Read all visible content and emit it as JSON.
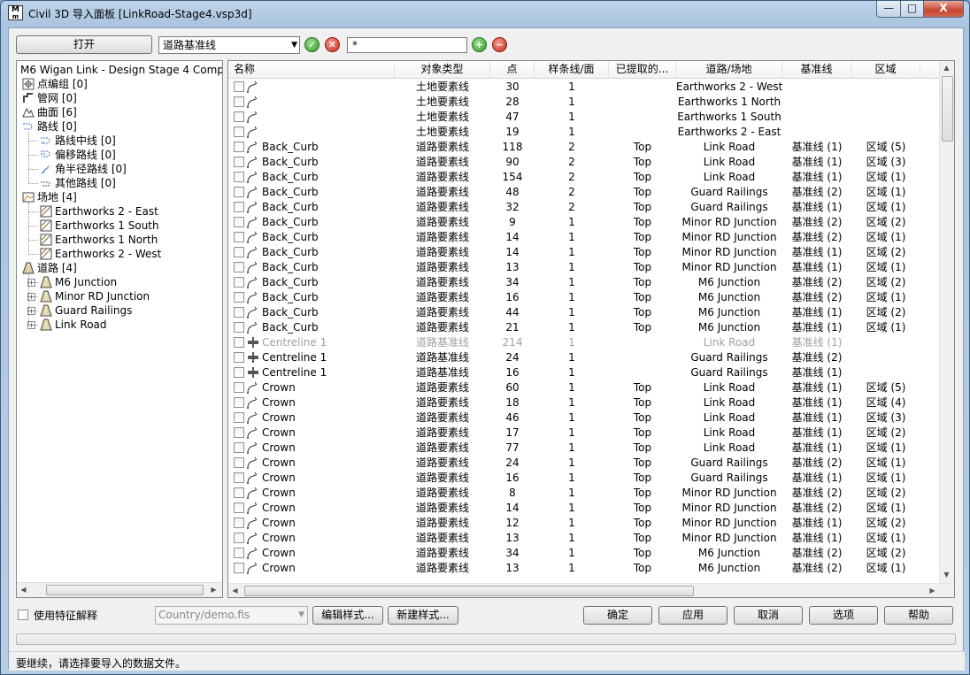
{
  "window": {
    "title": "Civil 3D 导入面板 [LinkRoad-Stage4.vsp3d]",
    "icon_text": "M",
    "minimize": "—",
    "maximize": "□",
    "close": "X"
  },
  "toolbar": {
    "open_label": "打开",
    "type_select_value": "道路基准线",
    "filter_value": "*"
  },
  "tree": {
    "root": "M6 Wigan Link - Design Stage 4 Complete.dwg",
    "items": [
      {
        "label": "点编组 [0]",
        "icon": "point-group-icon"
      },
      {
        "label": "管网 [0]",
        "icon": "pipe-network-icon"
      },
      {
        "label": "曲面 [6]",
        "icon": "surface-icon"
      },
      {
        "label": "路线 [0]",
        "icon": "alignment-icon"
      },
      {
        "label": "路线中线 [0]",
        "icon": "centerline-icon"
      },
      {
        "label": "偏移路线 [0]",
        "icon": "offset-alignment-icon"
      },
      {
        "label": "角半径路线 [0]",
        "icon": "curb-return-icon"
      },
      {
        "label": "其他路线 [0]",
        "icon": "misc-alignment-icon"
      },
      {
        "label": "场地 [4]",
        "icon": "site-icon"
      },
      {
        "label": "Earthworks 2 - East",
        "icon": "site-item-icon"
      },
      {
        "label": "Earthworks 1 South",
        "icon": "site-item-icon"
      },
      {
        "label": "Earthworks 1 North",
        "icon": "site-item-icon"
      },
      {
        "label": "Earthworks 2 - West",
        "icon": "site-item-icon"
      },
      {
        "label": "道路 [4]",
        "icon": "corridor-icon"
      },
      {
        "label": "M6 Junction",
        "icon": "corridor-item-icon"
      },
      {
        "label": "Minor RD Junction",
        "icon": "corridor-item-icon"
      },
      {
        "label": "Guard Railings",
        "icon": "corridor-item-icon"
      },
      {
        "label": "Link Road",
        "icon": "corridor-item-icon"
      }
    ]
  },
  "list": {
    "columns": [
      "名称",
      "对象类型",
      "点",
      "样条线/面",
      "已提取的...",
      "道路/场地",
      "基准线",
      "区域"
    ],
    "rows": [
      {
        "name": "",
        "type": "土地要素线",
        "pts": "30",
        "spl": "1",
        "ext": "",
        "road": "Earthworks 2 - West",
        "base": "",
        "reg": "",
        "icon": "feature-line-icon"
      },
      {
        "name": "",
        "type": "土地要素线",
        "pts": "28",
        "spl": "1",
        "ext": "",
        "road": "Earthworks 1 North",
        "base": "",
        "reg": "",
        "icon": "feature-line-icon"
      },
      {
        "name": "",
        "type": "土地要素线",
        "pts": "47",
        "spl": "1",
        "ext": "",
        "road": "Earthworks 1 South",
        "base": "",
        "reg": "",
        "icon": "feature-line-icon"
      },
      {
        "name": "",
        "type": "土地要素线",
        "pts": "19",
        "spl": "1",
        "ext": "",
        "road": "Earthworks 2 - East",
        "base": "",
        "reg": "",
        "icon": "feature-line-icon"
      },
      {
        "name": "Back_Curb",
        "type": "道路要素线",
        "pts": "118",
        "spl": "2",
        "ext": "Top",
        "road": "Link Road",
        "base": "基准线 (1)",
        "reg": "区域 (5)",
        "icon": "feature-line-icon"
      },
      {
        "name": "Back_Curb",
        "type": "道路要素线",
        "pts": "90",
        "spl": "2",
        "ext": "Top",
        "road": "Link Road",
        "base": "基准线 (1)",
        "reg": "区域 (3)",
        "icon": "feature-line-icon"
      },
      {
        "name": "Back_Curb",
        "type": "道路要素线",
        "pts": "154",
        "spl": "2",
        "ext": "Top",
        "road": "Link Road",
        "base": "基准线 (1)",
        "reg": "区域 (1)",
        "icon": "feature-line-icon"
      },
      {
        "name": "Back_Curb",
        "type": "道路要素线",
        "pts": "48",
        "spl": "2",
        "ext": "Top",
        "road": "Guard Railings",
        "base": "基准线 (2)",
        "reg": "区域 (1)",
        "icon": "feature-line-icon"
      },
      {
        "name": "Back_Curb",
        "type": "道路要素线",
        "pts": "32",
        "spl": "2",
        "ext": "Top",
        "road": "Guard Railings",
        "base": "基准线 (1)",
        "reg": "区域 (1)",
        "icon": "feature-line-icon"
      },
      {
        "name": "Back_Curb",
        "type": "道路要素线",
        "pts": "9",
        "spl": "1",
        "ext": "Top",
        "road": "Minor RD Junction",
        "base": "基准线 (2)",
        "reg": "区域 (2)",
        "icon": "feature-line-icon"
      },
      {
        "name": "Back_Curb",
        "type": "道路要素线",
        "pts": "14",
        "spl": "1",
        "ext": "Top",
        "road": "Minor RD Junction",
        "base": "基准线 (2)",
        "reg": "区域 (1)",
        "icon": "feature-line-icon"
      },
      {
        "name": "Back_Curb",
        "type": "道路要素线",
        "pts": "14",
        "spl": "1",
        "ext": "Top",
        "road": "Minor RD Junction",
        "base": "基准线 (1)",
        "reg": "区域 (2)",
        "icon": "feature-line-icon"
      },
      {
        "name": "Back_Curb",
        "type": "道路要素线",
        "pts": "13",
        "spl": "1",
        "ext": "Top",
        "road": "Minor RD Junction",
        "base": "基准线 (1)",
        "reg": "区域 (1)",
        "icon": "feature-line-icon"
      },
      {
        "name": "Back_Curb",
        "type": "道路要素线",
        "pts": "34",
        "spl": "1",
        "ext": "Top",
        "road": "M6 Junction",
        "base": "基准线 (2)",
        "reg": "区域 (2)",
        "icon": "feature-line-icon"
      },
      {
        "name": "Back_Curb",
        "type": "道路要素线",
        "pts": "16",
        "spl": "1",
        "ext": "Top",
        "road": "M6 Junction",
        "base": "基准线 (2)",
        "reg": "区域 (1)",
        "icon": "feature-line-icon"
      },
      {
        "name": "Back_Curb",
        "type": "道路要素线",
        "pts": "44",
        "spl": "1",
        "ext": "Top",
        "road": "M6 Junction",
        "base": "基准线 (1)",
        "reg": "区域 (2)",
        "icon": "feature-line-icon"
      },
      {
        "name": "Back_Curb",
        "type": "道路要素线",
        "pts": "21",
        "spl": "1",
        "ext": "Top",
        "road": "M6 Junction",
        "base": "基准线 (1)",
        "reg": "区域 (1)",
        "icon": "feature-line-icon"
      },
      {
        "name": "Centreline 1",
        "type": "道路基准线",
        "pts": "214",
        "spl": "1",
        "ext": "",
        "road": "Link Road",
        "base": "基准线 (1)",
        "reg": "",
        "icon": "baseline-icon",
        "dim": true
      },
      {
        "name": "Centreline 1",
        "type": "道路基准线",
        "pts": "24",
        "spl": "1",
        "ext": "",
        "road": "Guard Railings",
        "base": "基准线 (2)",
        "reg": "",
        "icon": "baseline-icon"
      },
      {
        "name": "Centreline 1",
        "type": "道路基准线",
        "pts": "16",
        "spl": "1",
        "ext": "",
        "road": "Guard Railings",
        "base": "基准线 (1)",
        "reg": "",
        "icon": "baseline-icon"
      },
      {
        "name": "Crown",
        "type": "道路要素线",
        "pts": "60",
        "spl": "1",
        "ext": "Top",
        "road": "Link Road",
        "base": "基准线 (1)",
        "reg": "区域 (5)",
        "icon": "feature-line-icon"
      },
      {
        "name": "Crown",
        "type": "道路要素线",
        "pts": "18",
        "spl": "1",
        "ext": "Top",
        "road": "Link Road",
        "base": "基准线 (1)",
        "reg": "区域 (4)",
        "icon": "feature-line-icon"
      },
      {
        "name": "Crown",
        "type": "道路要素线",
        "pts": "46",
        "spl": "1",
        "ext": "Top",
        "road": "Link Road",
        "base": "基准线 (1)",
        "reg": "区域 (3)",
        "icon": "feature-line-icon"
      },
      {
        "name": "Crown",
        "type": "道路要素线",
        "pts": "17",
        "spl": "1",
        "ext": "Top",
        "road": "Link Road",
        "base": "基准线 (1)",
        "reg": "区域 (2)",
        "icon": "feature-line-icon"
      },
      {
        "name": "Crown",
        "type": "道路要素线",
        "pts": "77",
        "spl": "1",
        "ext": "Top",
        "road": "Link Road",
        "base": "基准线 (1)",
        "reg": "区域 (1)",
        "icon": "feature-line-icon"
      },
      {
        "name": "Crown",
        "type": "道路要素线",
        "pts": "24",
        "spl": "1",
        "ext": "Top",
        "road": "Guard Railings",
        "base": "基准线 (2)",
        "reg": "区域 (1)",
        "icon": "feature-line-icon"
      },
      {
        "name": "Crown",
        "type": "道路要素线",
        "pts": "16",
        "spl": "1",
        "ext": "Top",
        "road": "Guard Railings",
        "base": "基准线 (1)",
        "reg": "区域 (1)",
        "icon": "feature-line-icon"
      },
      {
        "name": "Crown",
        "type": "道路要素线",
        "pts": "8",
        "spl": "1",
        "ext": "Top",
        "road": "Minor RD Junction",
        "base": "基准线 (2)",
        "reg": "区域 (2)",
        "icon": "feature-line-icon"
      },
      {
        "name": "Crown",
        "type": "道路要素线",
        "pts": "14",
        "spl": "1",
        "ext": "Top",
        "road": "Minor RD Junction",
        "base": "基准线 (2)",
        "reg": "区域 (1)",
        "icon": "feature-line-icon"
      },
      {
        "name": "Crown",
        "type": "道路要素线",
        "pts": "12",
        "spl": "1",
        "ext": "Top",
        "road": "Minor RD Junction",
        "base": "基准线 (1)",
        "reg": "区域 (2)",
        "icon": "feature-line-icon"
      },
      {
        "name": "Crown",
        "type": "道路要素线",
        "pts": "13",
        "spl": "1",
        "ext": "Top",
        "road": "Minor RD Junction",
        "base": "基准线 (1)",
        "reg": "区域 (1)",
        "icon": "feature-line-icon"
      },
      {
        "name": "Crown",
        "type": "道路要素线",
        "pts": "34",
        "spl": "1",
        "ext": "Top",
        "road": "M6 Junction",
        "base": "基准线 (2)",
        "reg": "区域 (2)",
        "icon": "feature-line-icon"
      },
      {
        "name": "Crown",
        "type": "道路要素线",
        "pts": "13",
        "spl": "1",
        "ext": "Top",
        "road": "M6 Junction",
        "base": "基准线 (2)",
        "reg": "区域 (1)",
        "icon": "feature-line-icon"
      }
    ]
  },
  "bottom": {
    "feature_label": "使用特征解释",
    "style_file": "Country/demo.fis",
    "edit_style": "编辑样式...",
    "new_style": "新建样式...",
    "ok": "确定",
    "apply": "应用",
    "cancel": "取消",
    "options": "选项",
    "help": "帮助"
  },
  "status": "要继续，请选择要导入的数据文件。",
  "colors": {
    "accent_green": "#2f9a2a",
    "accent_red": "#c8261a",
    "dim_text": "#a0a0a0"
  }
}
